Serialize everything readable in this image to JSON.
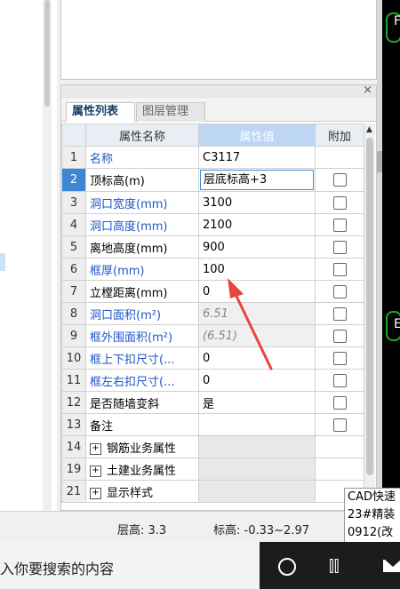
{
  "panel": {
    "tabs": [
      "属性列表",
      "图层管理"
    ],
    "close": "×",
    "columns": {
      "num": "",
      "name": "属性名称",
      "value": "属性值",
      "extra": "附加"
    },
    "rows": [
      {
        "num": "1",
        "name": "名称",
        "value": "C3117",
        "blue": true,
        "checkbox": false
      },
      {
        "num": "2",
        "name": "顶标高(m)",
        "value": "层底标高+3",
        "blue": false,
        "checkbox": true,
        "current": true,
        "editing": true
      },
      {
        "num": "3",
        "name": "洞口宽度(mm)",
        "value": "3100",
        "blue": true,
        "checkbox": true
      },
      {
        "num": "4",
        "name": "洞口高度(mm)",
        "value": "2100",
        "blue": true,
        "checkbox": true
      },
      {
        "num": "5",
        "name": "离地高度(mm)",
        "value": "900",
        "blue": false,
        "checkbox": true
      },
      {
        "num": "6",
        "name": "框厚(mm)",
        "value": "100",
        "blue": true,
        "checkbox": true
      },
      {
        "num": "7",
        "name": "立樘距离(mm)",
        "value": "0",
        "blue": false,
        "checkbox": true
      },
      {
        "num": "8",
        "name": "洞口面积(m²)",
        "value": "6.51",
        "blue": true,
        "checkbox": true,
        "readonly": true
      },
      {
        "num": "9",
        "name": "框外围面积(m²)",
        "value": "(6.51)",
        "blue": true,
        "checkbox": true,
        "readonly": true
      },
      {
        "num": "10",
        "name": "框上下扣尺寸(...",
        "value": "0",
        "blue": true,
        "checkbox": true
      },
      {
        "num": "11",
        "name": "框左右扣尺寸(...",
        "value": "0",
        "blue": true,
        "checkbox": true
      },
      {
        "num": "12",
        "name": "是否随墙变斜",
        "value": "是",
        "blue": false,
        "checkbox": true
      },
      {
        "num": "13",
        "name": "备注",
        "value": "",
        "blue": false,
        "checkbox": true
      }
    ],
    "groups": [
      {
        "num": "14",
        "name": "钢筋业务属性"
      },
      {
        "num": "19",
        "name": "土建业务属性"
      },
      {
        "num": "21",
        "name": "显示样式"
      }
    ]
  },
  "status": {
    "floor_height": "层高:  3.3",
    "elevation": "标高:  -0.33~2.97"
  },
  "tooltip": {
    "lines": [
      "CAD快速",
      "23#精装",
      "0912(改"
    ]
  },
  "cad": {
    "labels": [
      "F",
      "E"
    ]
  },
  "taskbar": {
    "search_placeholder": "入你要搜索的内容",
    "taskview_glyph": "⫿⫿"
  },
  "colors": {
    "accent": "#3d86d6",
    "blue_text": "#1e55c8",
    "arrow": "#e8453c",
    "cad_green": "#1fa81f"
  }
}
